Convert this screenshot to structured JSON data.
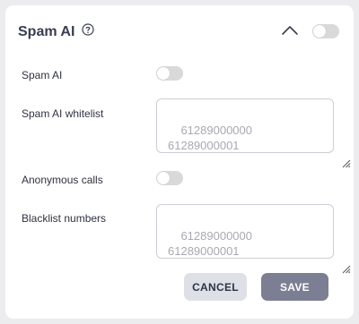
{
  "panel": {
    "title": "Spam AI",
    "help_icon": "help-circle-icon",
    "collapse_icon": "chevron-up-icon",
    "enabled": false
  },
  "settings": {
    "spam_ai": {
      "label": "Spam AI",
      "enabled": false
    },
    "whitelist": {
      "label": "Spam AI whitelist",
      "placeholder": "61289000000\n61289000001"
    },
    "anonymous_calls": {
      "label": "Anonymous calls",
      "enabled": false
    },
    "blacklist": {
      "label": "Blacklist numbers",
      "placeholder": "61289000000\n61289000001"
    }
  },
  "actions": {
    "cancel_label": "CANCEL",
    "save_label": "SAVE"
  },
  "colors": {
    "background": "#ececee",
    "title": "#3a3d52",
    "toggle_off": "#d9d9d9",
    "cancel_bg": "#dde1e7",
    "save_bg": "#7c7e94"
  }
}
